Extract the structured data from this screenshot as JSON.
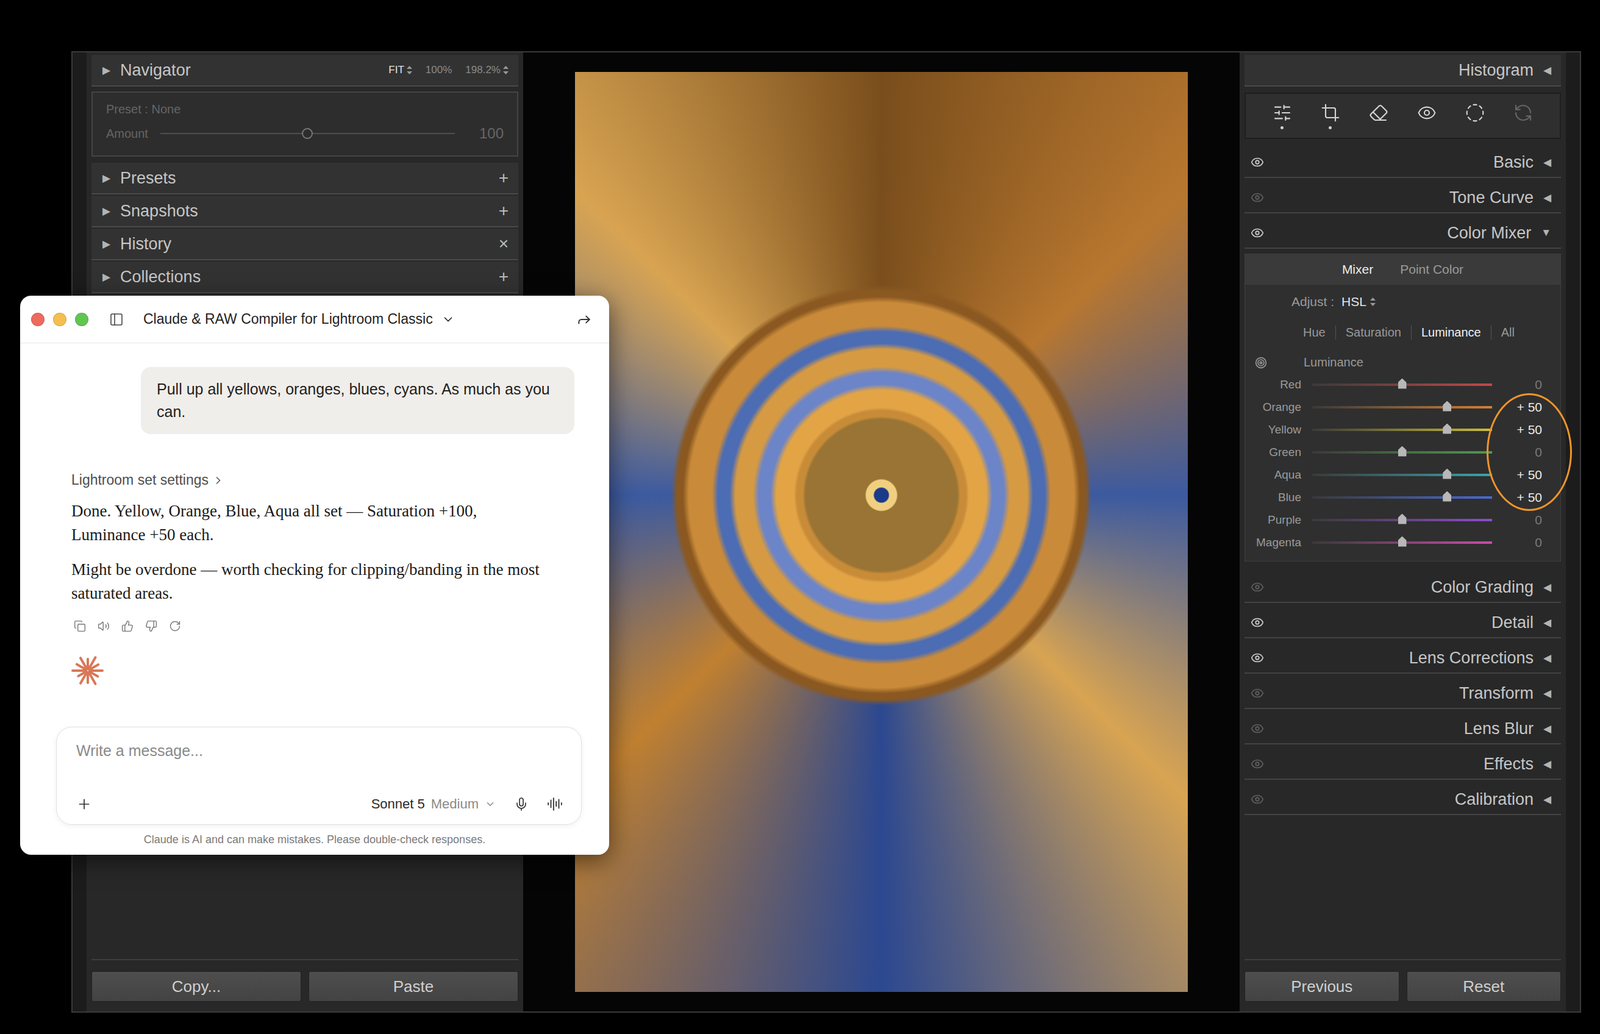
{
  "left_panel": {
    "navigator": {
      "arrow": "▶",
      "title": "Navigator",
      "zoom": [
        {
          "label": "FIT",
          "selected": true,
          "menu": true
        },
        {
          "label": "100%",
          "selected": false,
          "menu": false
        },
        {
          "label": "198.2%",
          "selected": false,
          "menu": true
        }
      ],
      "preset": "Preset : None",
      "amount": {
        "label": "Amount",
        "level": 0.5,
        "reading": "100",
        "disabled": true
      }
    },
    "panels": [
      {
        "arrow": "▶",
        "title": "Presets",
        "action": "+",
        "expanded": false
      },
      {
        "arrow": "▶",
        "title": "Snapshots",
        "action": "+",
        "expanded": false
      },
      {
        "arrow": "▶",
        "title": "History",
        "action": "×",
        "expanded": false
      },
      {
        "arrow": "▶",
        "title": "Collections",
        "action": "+",
        "expanded": false
      }
    ],
    "buttons": [
      "Copy...",
      "Paste"
    ]
  },
  "right_panel": {
    "histogram": {
      "title": "Histogram",
      "arrow": "◀"
    },
    "tools": [
      {
        "kind": "edit",
        "marked": true,
        "disabled": false
      },
      {
        "kind": "crop",
        "marked": true,
        "disabled": false
      },
      {
        "kind": "heal",
        "marked": false,
        "disabled": false
      },
      {
        "kind": "redeye",
        "marked": false,
        "disabled": false
      },
      {
        "kind": "mask",
        "marked": false,
        "disabled": false
      },
      {
        "kind": "reset",
        "marked": false,
        "disabled": true
      }
    ],
    "sections_top": [
      {
        "title": "Basic",
        "arrow": "◀",
        "enabled": true,
        "expanded": false
      },
      {
        "title": "Tone Curve",
        "arrow": "◀",
        "enabled": false,
        "expanded": false
      },
      {
        "title": "Color Mixer",
        "arrow": "▼",
        "enabled": true,
        "expanded": true
      }
    ],
    "color_mixer": {
      "modes": [
        {
          "label": "Mixer",
          "selected": true
        },
        {
          "label": "Point Color",
          "selected": false
        }
      ],
      "adjust_label": "Adjust :",
      "adjust_value": "HSL",
      "channels": [
        {
          "label": "Hue",
          "selected": false
        },
        {
          "label": "Saturation",
          "selected": false
        },
        {
          "label": "Luminance",
          "selected": true
        },
        {
          "label": "All",
          "selected": false
        }
      ],
      "group_title": "Luminance",
      "sliders": [
        {
          "name": "Red",
          "level": 0.5,
          "reading": "0",
          "color": "#c24848",
          "highlighted": false
        },
        {
          "name": "Orange",
          "level": 0.75,
          "reading": "+ 50",
          "color": "#d08038",
          "highlighted": true
        },
        {
          "name": "Yellow",
          "level": 0.75,
          "reading": "+ 50",
          "color": "#cbbf3a",
          "highlighted": true
        },
        {
          "name": "Green",
          "level": 0.5,
          "reading": "0",
          "color": "#4c9c4c",
          "highlighted": false
        },
        {
          "name": "Aqua",
          "level": 0.75,
          "reading": "+ 50",
          "color": "#3aa4ae",
          "highlighted": true
        },
        {
          "name": "Blue",
          "level": 0.75,
          "reading": "+ 50",
          "color": "#4a6ad0",
          "highlighted": true
        },
        {
          "name": "Purple",
          "level": 0.5,
          "reading": "0",
          "color": "#8c4ccc",
          "highlighted": false
        },
        {
          "name": "Magenta",
          "level": 0.5,
          "reading": "0",
          "color": "#c84ca8",
          "highlighted": false
        }
      ]
    },
    "sections_bottom": [
      {
        "title": "Color Grading",
        "arrow": "◀",
        "enabled": false,
        "expanded": false
      },
      {
        "title": "Detail",
        "arrow": "◀",
        "enabled": true,
        "expanded": false
      },
      {
        "title": "Lens Corrections",
        "arrow": "◀",
        "enabled": true,
        "expanded": false
      },
      {
        "title": "Transform",
        "arrow": "◀",
        "enabled": false,
        "expanded": false
      },
      {
        "title": "Lens Blur",
        "arrow": "◀",
        "enabled": false,
        "expanded": false
      },
      {
        "title": "Effects",
        "arrow": "◀",
        "enabled": false,
        "expanded": false
      },
      {
        "title": "Calibration",
        "arrow": "◀",
        "enabled": false,
        "expanded": false
      }
    ],
    "buttons": [
      "Previous",
      "Reset"
    ]
  },
  "chat": {
    "title": "Claude & RAW Compiler for Lightroom Classic",
    "user_message": "Pull up all yellows, oranges, blues, cyans. As much as you can.",
    "tool_label": "Lightroom set settings",
    "reply": [
      "Done. Yellow, Orange, Blue, Aqua all set — Saturation +100, Luminance +50 each.",
      "Might be overdone — worth checking for clipping/banding in the most saturated areas."
    ],
    "placeholder": "Write a message...",
    "model": "Sonnet 5",
    "effort": "Medium",
    "footer": "Claude is AI and can make mistakes. Please double-check responses."
  }
}
